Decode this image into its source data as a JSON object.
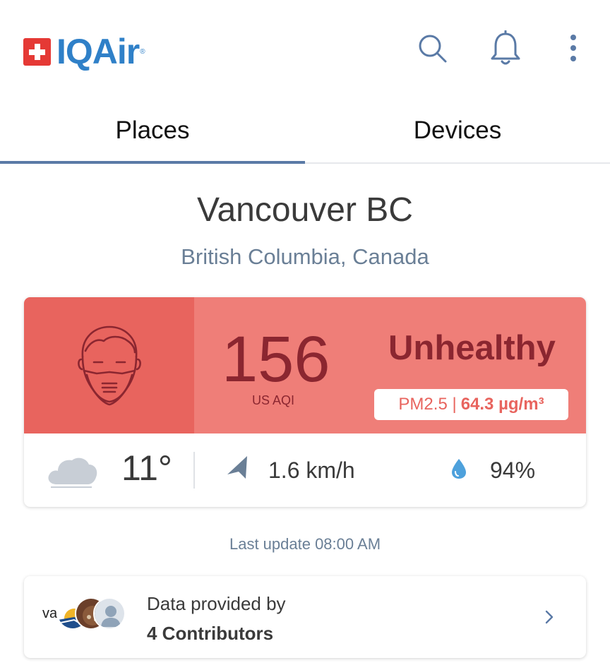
{
  "header": {
    "logo_text": "IQAir",
    "logo_reg": "®",
    "icons": [
      "search-icon",
      "bell-icon",
      "more-vertical-icon"
    ]
  },
  "tabs": [
    {
      "label": "Places",
      "active": true
    },
    {
      "label": "Devices",
      "active": false
    }
  ],
  "location": {
    "city": "Vancouver BC",
    "region": "British Columbia, Canada"
  },
  "aqi": {
    "value": "156",
    "unit_label": "US AQI",
    "status": "Unhealthy",
    "pollutant": "PM2.5 |",
    "concentration": "64.3 µg/m³",
    "colors": {
      "face_bg": "#e8645e",
      "row_bg": "#ef7e78",
      "text": "#8b2630"
    }
  },
  "weather": {
    "temperature": "11°",
    "wind": "1.6 km/h",
    "humidity": "94%",
    "icons": [
      "cloud-icon",
      "wind-direction-icon",
      "humidity-drop-icon"
    ]
  },
  "last_update": "Last update 08:00 AM",
  "contributors": {
    "line1": "Data provided by",
    "line2": "4 Contributors",
    "avatar_text": "va"
  }
}
